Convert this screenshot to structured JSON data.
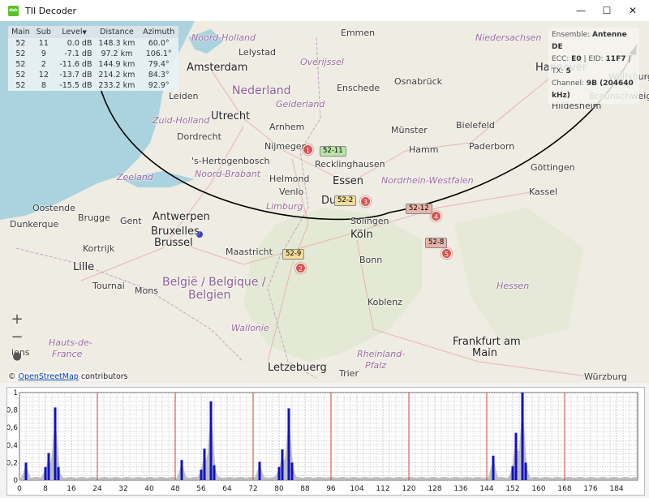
{
  "window": {
    "title": "TII Decoder",
    "icon_text": "dab",
    "minimize": "—",
    "maximize": "☐",
    "close": "✕"
  },
  "table": {
    "headers": [
      "Main",
      "Sub",
      "Level",
      "Distance",
      "Azimuth"
    ],
    "sort_indicator": "▼",
    "rows": [
      [
        "52",
        "11",
        "0.0 dB",
        "148.3 km",
        "60.0°"
      ],
      [
        "52",
        "9",
        "-7.1 dB",
        "97.2 km",
        "106.1°"
      ],
      [
        "52",
        "2",
        "-11.6 dB",
        "144.9 km",
        "79.4°"
      ],
      [
        "52",
        "12",
        "-13.7 dB",
        "214.2 km",
        "84.3°"
      ],
      [
        "52",
        "8",
        "-15.5 dB",
        "233.2 km",
        "92.9°"
      ]
    ]
  },
  "info": {
    "ensemble_label": "Ensemble:",
    "ensemble": "Antenne DE",
    "ecc_label": "ECC:",
    "ecc": "E0",
    "eid_label": "EID:",
    "eid": "11F7",
    "tx_label": "TX:",
    "tx": "5",
    "channel_label": "Channel:",
    "channel": "9B (204640 kHz)"
  },
  "map": {
    "cities": [
      "Noord-Holland",
      "Amsterdam",
      "Lelystad",
      "Overijssel",
      "Emmen",
      "Niedersachsen",
      "Hannover",
      "Wolfsburg",
      "Leiden",
      "Nederland",
      "Gelderland",
      "Enschede",
      "Osnabrück",
      "Braunschweig",
      "Hildesheim",
      "Utrecht",
      "Zuid-Holland",
      "Arnhem",
      "Münster",
      "Bielefeld",
      "Dordrecht",
      "Nijmegen",
      "Hamm",
      "Paderborn",
      "'s-Hertogenbosch",
      "Recklinghausen",
      "Göttingen",
      "Zeeland",
      "Noord-Brabant",
      "Helmond",
      "Essen",
      "Nordrhein-Westfalen",
      "Venlo",
      "Oostende",
      "Brugge",
      "Gent",
      "Antwerpen",
      "Du",
      "Solingen",
      "Kassel",
      "Dunkerque",
      "Limburg",
      "Bruxelles",
      "Brussel",
      "Kortrijk",
      "Lille",
      "Maastricht",
      "Köln",
      "Bonn",
      "Tournai",
      "Mons",
      "België / Belgique /",
      "Belgien",
      "Wallonie",
      "Koblenz",
      "Hessen",
      "Hauts-de-",
      "France",
      "Rheinland-",
      "Pfalz",
      "Frankfurt am",
      "Main",
      "Letzebuerg",
      "Trier",
      "Würzburg",
      "iens"
    ],
    "markers": [
      "1",
      "2",
      "3",
      "4",
      "5"
    ],
    "tags": [
      "52-11",
      "52-2",
      "52-12",
      "52-8",
      "52-9"
    ],
    "zoom_in": "+",
    "zoom_out": "−",
    "locate": "●",
    "attribution_prefix": "© ",
    "attribution_link": "OpenStreetMap",
    "attribution_suffix": " contributors",
    "colors": {
      "sea": "#aad3df",
      "land": "#efece3",
      "marker": "#d9534f",
      "tag_green": "#b9e6a6",
      "tag_yellow": "#f2dc9a",
      "tag_red": "#e8b4a8",
      "arc": "#000000",
      "receiver": "#3b3bd9"
    }
  },
  "chart_data": {
    "type": "bar",
    "xlim": [
      0,
      190.5
    ],
    "ylim": [
      0,
      1
    ],
    "xticks": [
      0,
      8,
      16,
      24,
      32,
      40,
      48,
      56,
      64,
      72,
      80,
      88,
      96,
      104,
      112,
      120,
      128,
      136,
      144,
      152,
      160,
      168,
      176,
      184
    ],
    "yticks": [
      1,
      0.8,
      0.6,
      0.4,
      0.2,
      0
    ],
    "ytick_labels": [
      "1",
      "0,8",
      "0,6",
      "0,4",
      "0,2",
      "0"
    ],
    "grid": true,
    "markers_x": [
      24,
      48,
      72,
      96,
      120,
      144,
      168
    ],
    "series": [
      {
        "x": [
          2,
          8,
          9,
          11,
          12,
          50,
          56,
          57,
          59,
          60,
          74,
          80,
          81,
          83,
          84,
          146,
          152,
          153,
          155,
          156
        ],
        "values": [
          0.2,
          0.15,
          0.31,
          0.83,
          0.15,
          0.23,
          0.12,
          0.36,
          0.9,
          0.17,
          0.21,
          0.15,
          0.35,
          0.82,
          0.2,
          0.28,
          0.16,
          0.54,
          1.0,
          0.2
        ]
      }
    ],
    "colors": {
      "bars": "#1010c8",
      "background_level": "#b4b4b4",
      "markers": "#d04040"
    }
  }
}
